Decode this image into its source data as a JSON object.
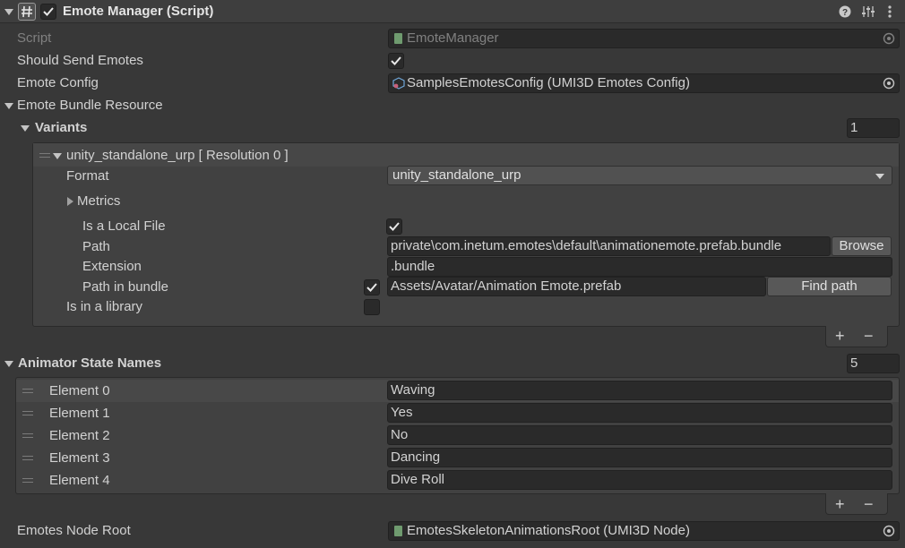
{
  "header": {
    "title": "Emote Manager (Script)",
    "enabled": true,
    "icons": [
      "hash-script-icon",
      "help-icon",
      "preset-icon",
      "more-options-icon"
    ]
  },
  "fields": {
    "script_label": "Script",
    "script_value": "EmoteManager",
    "should_send_label": "Should Send Emotes",
    "should_send_value": true,
    "emote_config_label": "Emote Config",
    "emote_config_value": "SamplesEmotesConfig (UMI3D Emotes Config)",
    "bundle_label": "Emote Bundle Resource",
    "variants_label": "Variants",
    "variants_count": "1",
    "variant": {
      "title": "unity_standalone_urp [ Resolution 0 ]",
      "format_label": "Format",
      "format_value": "unity_standalone_urp",
      "metrics_label": "Metrics",
      "local_file_label": "Is a Local File",
      "local_file_value": true,
      "path_label": "Path",
      "path_value": "private\\com.inetum.emotes\\default\\animationemote.prefab.bundle",
      "browse_label": "Browse",
      "extension_label": "Extension",
      "extension_value": ".bundle",
      "path_in_bundle_label": "Path in bundle",
      "path_in_bundle_checked": true,
      "path_in_bundle_value": "Assets/Avatar/Animation Emote.prefab",
      "find_path_label": "Find path",
      "in_library_label": "Is in a library",
      "in_library_value": false
    },
    "add_symbol": "+",
    "remove_symbol": "−",
    "animator_label": "Animator State Names",
    "animator_count": "5",
    "elements": [
      {
        "label": "Element 0",
        "value": "Waving"
      },
      {
        "label": "Element 1",
        "value": "Yes"
      },
      {
        "label": "Element 2",
        "value": "No"
      },
      {
        "label": "Element 3",
        "value": "Dancing"
      },
      {
        "label": "Element 4",
        "value": "Dive Roll"
      }
    ],
    "node_root_label": "Emotes Node Root",
    "node_root_value": "EmotesSkeletonAnimationsRoot (UMI3D Node)"
  }
}
